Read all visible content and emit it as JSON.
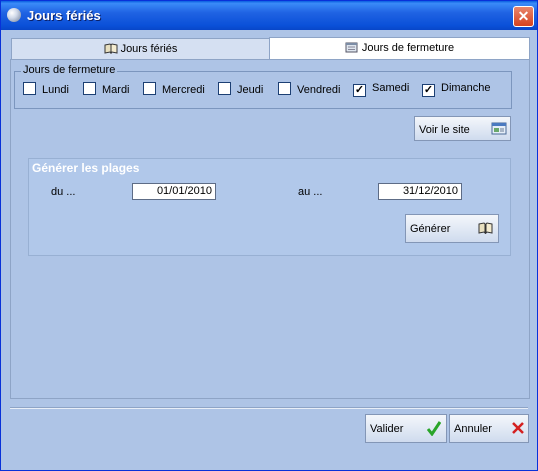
{
  "window": {
    "title": "Jours fériés",
    "close_glyph": "✕"
  },
  "tabs": [
    {
      "label": "Jours fériés",
      "icon": "book-icon",
      "active": false
    },
    {
      "label": "Jours de fermeture",
      "icon": "calendar-icon",
      "active": true
    }
  ],
  "closing_days": {
    "legend": "Jours de fermeture",
    "days": [
      {
        "label": "Lundi",
        "checked": false
      },
      {
        "label": "Mardi",
        "checked": false
      },
      {
        "label": "Mercredi",
        "checked": false
      },
      {
        "label": "Jeudi",
        "checked": false
      },
      {
        "label": "Vendredi",
        "checked": false
      },
      {
        "label": "Samedi",
        "checked": true
      },
      {
        "label": "Dimanche",
        "checked": true
      }
    ]
  },
  "buttons": {
    "voir_site": "Voir le site",
    "generer": "Générer",
    "valider": "Valider",
    "annuler": "Annuler"
  },
  "generate": {
    "title": "Générer les plages",
    "from_label": "du ...",
    "from_value": "01/01/2010",
    "to_label": "au ...",
    "to_value": "31/12/2010"
  },
  "colors": {
    "accent": "#2063e3",
    "panel": "#aec4e6",
    "ok_green": "#2aa52a",
    "cancel_red": "#d42020"
  }
}
